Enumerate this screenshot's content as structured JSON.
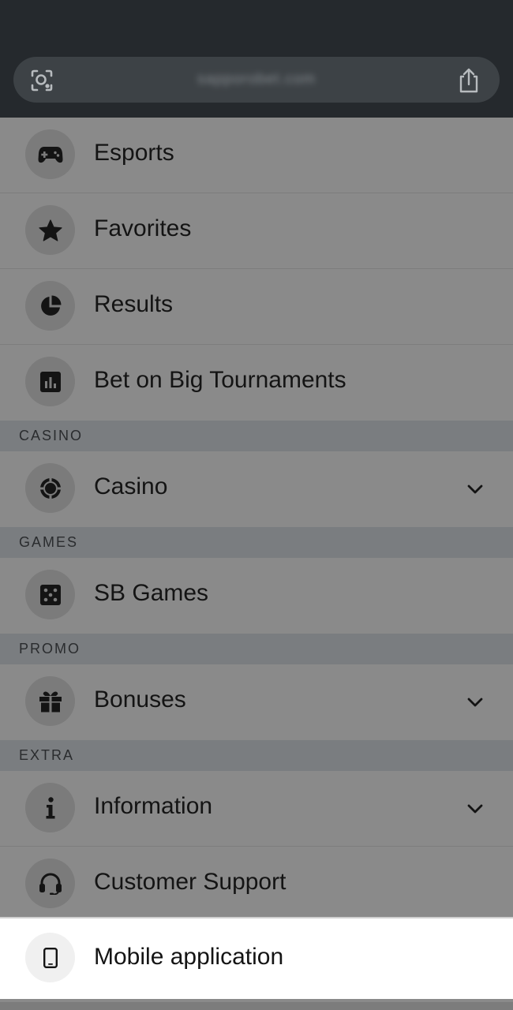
{
  "browser": {
    "url": "sapporobet.com",
    "lens_icon": "camera-lens-icon",
    "share_icon": "share-icon"
  },
  "menu": {
    "top_items": [
      {
        "label": "Esports",
        "icon": "gamepad-icon"
      },
      {
        "label": "Favorites",
        "icon": "star-icon"
      },
      {
        "label": "Results",
        "icon": "pie-chart-icon"
      },
      {
        "label": "Bet on Big Tournaments",
        "icon": "bar-chart-icon"
      }
    ],
    "sections": {
      "casino": {
        "title": "CASINO",
        "item": {
          "label": "Casino",
          "icon": "poker-chip-icon"
        }
      },
      "games": {
        "title": "GAMES",
        "item": {
          "label": "SB Games",
          "icon": "dice-icon"
        }
      },
      "promo": {
        "title": "PROMO",
        "item": {
          "label": "Bonuses",
          "icon": "gift-icon"
        }
      },
      "extra": {
        "title": "EXTRA",
        "items": [
          {
            "label": "Information",
            "icon": "info-icon"
          },
          {
            "label": "Customer Support",
            "icon": "headset-icon"
          },
          {
            "label": "Mobile application",
            "icon": "smartphone-icon"
          }
        ]
      }
    }
  }
}
